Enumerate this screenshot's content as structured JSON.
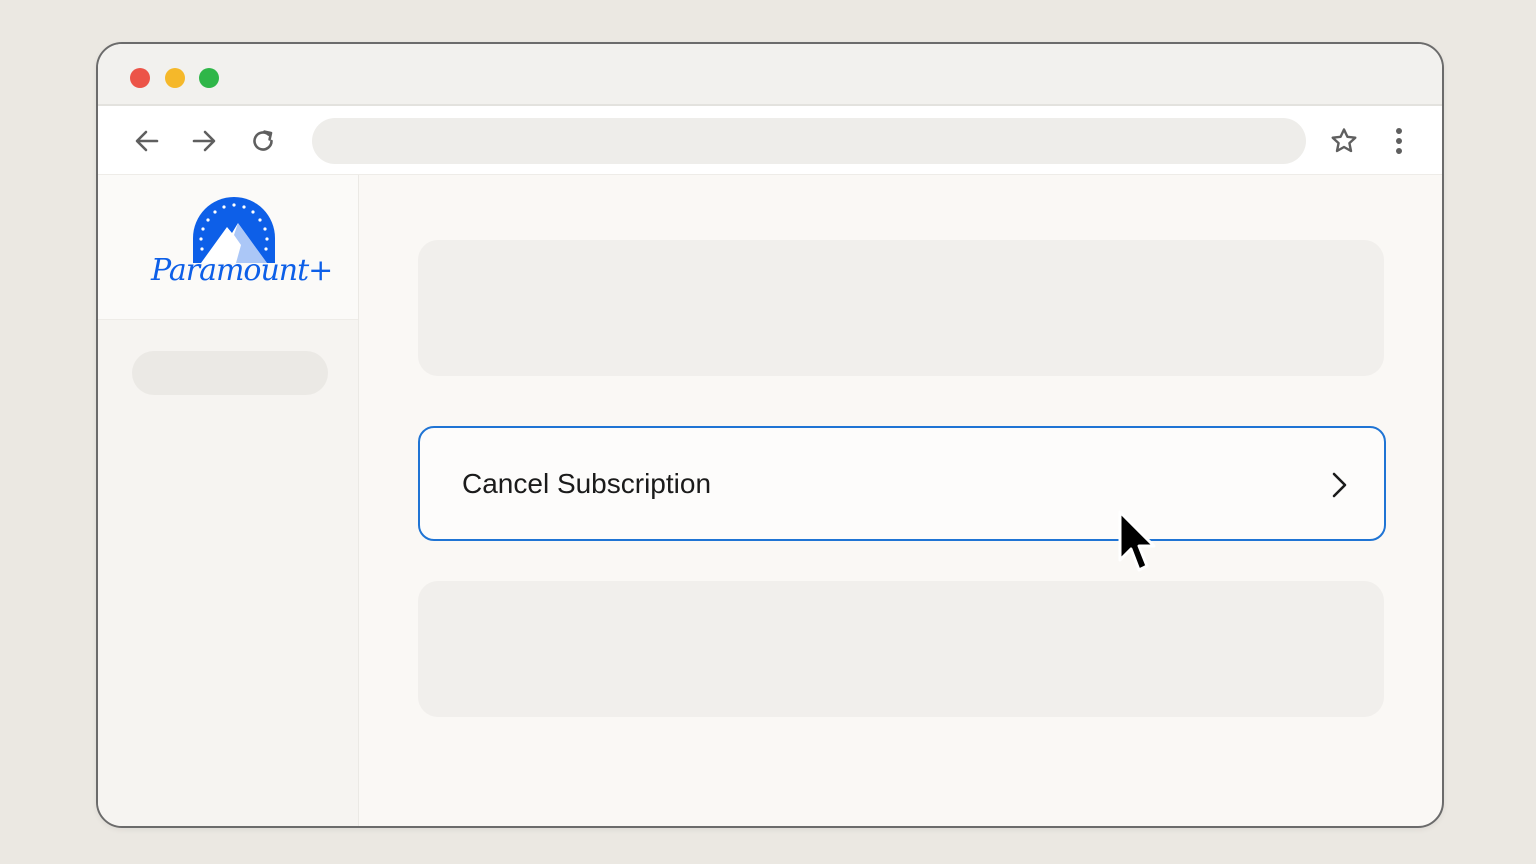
{
  "window": {
    "traffic_lights": [
      "close",
      "minimize",
      "zoom"
    ],
    "colors": {
      "close": "#ec5448",
      "minimize": "#f5b82a",
      "zoom": "#2fb648"
    }
  },
  "toolbar": {
    "back_icon": "arrow-left-icon",
    "forward_icon": "arrow-right-icon",
    "reload_icon": "reload-icon",
    "address_value": "",
    "bookmark_icon": "star-icon",
    "menu_icon": "kebab-menu-icon"
  },
  "sidebar": {
    "logo": {
      "text": "Paramount+",
      "color": "#0d5fe8"
    }
  },
  "main": {
    "cancel_label": "Cancel Subscription",
    "cancel_icon": "chevron-right-icon",
    "accent_color": "#1f74d4"
  }
}
